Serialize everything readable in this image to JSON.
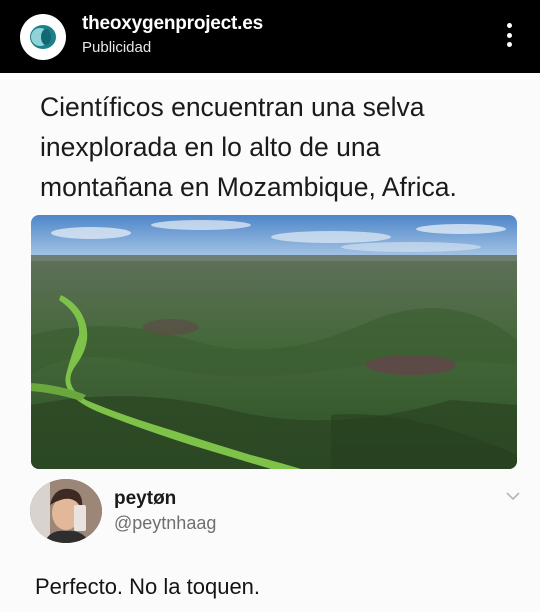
{
  "ad_header": {
    "account_name": "theoxygenproject.es",
    "sponsored_label": "Publicidad",
    "logo_icon": "oxygen-project-logo-icon",
    "more_icon": "vertical-dots-icon"
  },
  "post": {
    "headline": "Científicos encuentran una selva inexplorada en lo alto de una montañana en Mozambique, Africa.",
    "photo_description_icon": "aerial-landscape-photo"
  },
  "tweet": {
    "display_name": "peytøn",
    "handle": "@peytnhaag",
    "text": "Perfecto. No la toquen.",
    "chevron_icon": "chevron-down-icon"
  },
  "colors": {
    "header_bg": "#000000",
    "logo_teal": "#1c7f8a",
    "logo_light": "#8fd3d9"
  }
}
